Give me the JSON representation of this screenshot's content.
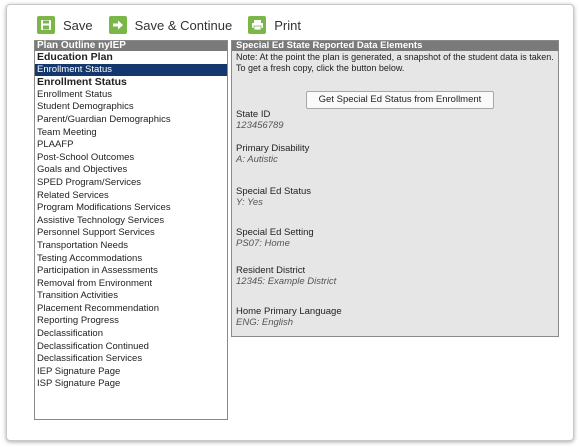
{
  "toolbar": {
    "save_label": "Save",
    "save_continue_label": "Save & Continue",
    "print_label": "Print"
  },
  "outline": {
    "header": "Plan Outline nyIEP",
    "items": [
      {
        "label": "Education Plan",
        "bold": true
      },
      {
        "label": "Enrollment Status",
        "selected": true
      },
      {
        "label": "Enrollment Status",
        "bold": true
      },
      {
        "label": "Enrollment Status"
      },
      {
        "label": "Student Demographics"
      },
      {
        "label": "Parent/Guardian Demographics"
      },
      {
        "label": "Team Meeting"
      },
      {
        "label": "PLAAFP"
      },
      {
        "label": "Post-School Outcomes"
      },
      {
        "label": "Goals and Objectives"
      },
      {
        "label": "SPED Program/Services"
      },
      {
        "label": "Related Services"
      },
      {
        "label": "Program Modifications Services"
      },
      {
        "label": "Assistive Technology Services"
      },
      {
        "label": "Personnel Support Services"
      },
      {
        "label": "Transportation Needs"
      },
      {
        "label": "Testing Accommodations"
      },
      {
        "label": "Participation in Assessments"
      },
      {
        "label": "Removal from Environment"
      },
      {
        "label": "Transition Activities"
      },
      {
        "label": "Placement Recommendation"
      },
      {
        "label": "Reporting Progress"
      },
      {
        "label": "Declassification"
      },
      {
        "label": "Declassification Continued"
      },
      {
        "label": "Declassification Services"
      },
      {
        "label": "IEP Signature Page"
      },
      {
        "label": "ISP Signature Page"
      }
    ]
  },
  "panel": {
    "header": "Special Ed State Reported Data Elements",
    "note": "Note: At the point the plan is generated, a snapshot of the student data is taken. To get a fresh copy, click the button below.",
    "button_label": "Get Special Ed Status from Enrollment",
    "fields": [
      {
        "label": "State ID",
        "value": "123456789"
      },
      {
        "label": "Primary Disability",
        "value": "A: Autistic"
      },
      {
        "label": "Special Ed Status",
        "value": "Y: Yes"
      },
      {
        "label": "Special Ed Setting",
        "value": "PS07: Home"
      },
      {
        "label": "Resident District",
        "value": "12345: Example District"
      },
      {
        "label": "Home Primary Language",
        "value": "ENG: English"
      }
    ]
  },
  "colors": {
    "accent_green": "#7ab648",
    "selected_bg": "#14386e",
    "header_gray": "#7a7a7a",
    "panel_bg": "#e6e6e6"
  }
}
